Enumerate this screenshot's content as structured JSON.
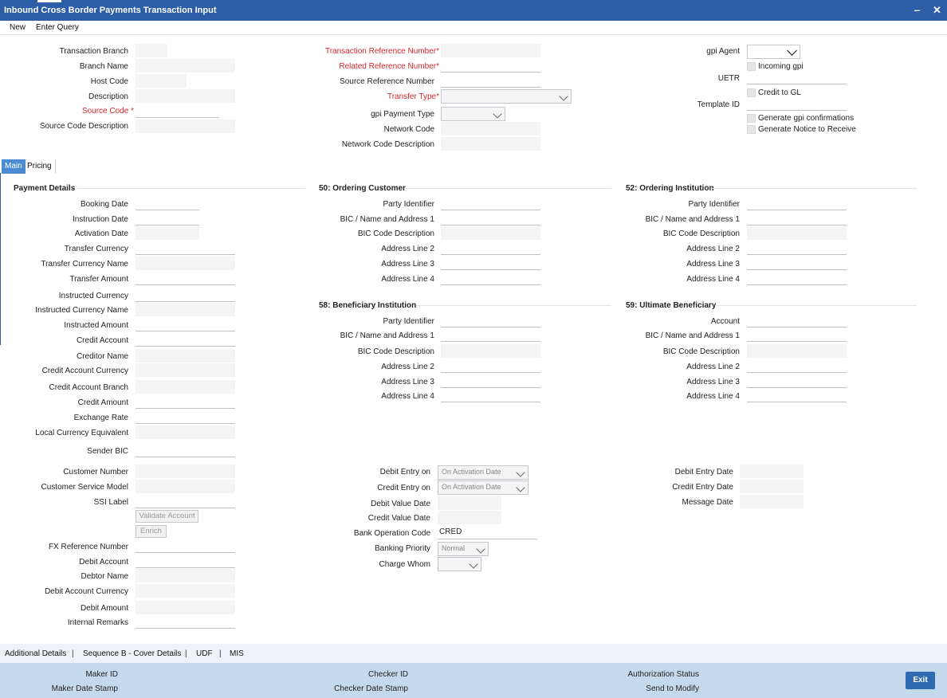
{
  "window": {
    "title": "Inbound Cross Border Payments Transaction Input",
    "minimize": "‒",
    "close": "✕"
  },
  "menu": {
    "new": "New",
    "enter_query": "Enter Query"
  },
  "header_left": {
    "transaction_branch": "Transaction Branch",
    "branch_name": "Branch Name",
    "host_code": "Host Code",
    "description": "Description",
    "source_code": "Source Code",
    "source_code_description": "Source Code Description"
  },
  "header_mid": {
    "txn_ref": "Transaction Reference Number",
    "related_ref": "Related Reference Number",
    "source_ref": "Source Reference Number",
    "transfer_type": "Transfer Type",
    "gpi_payment_type": "gpi Payment Type",
    "network_code": "Network Code",
    "network_code_desc": "Network Code Description"
  },
  "header_right": {
    "gpi_agent": "gpi Agent",
    "incoming_gpi": "Incoming gpi",
    "uetr": "UETR",
    "credit_to_gl": "Credit to GL",
    "template_id": "Template ID",
    "generate_gpi_confirmations": "Generate gpi confirmations",
    "generate_notice": "Generate Notice to Receive"
  },
  "required_mark": "*",
  "tabs": {
    "main": "Main",
    "pricing": "Pricing"
  },
  "payment_details": {
    "title": "Payment Details",
    "booking_date": "Booking Date",
    "instruction_date": "Instruction Date",
    "activation_date": "Activation Date",
    "transfer_currency": "Transfer Currency",
    "transfer_currency_name": "Transfer Currency Name",
    "transfer_amount": "Transfer Amount",
    "instructed_currency": "Instructed Currency",
    "instructed_currency_name": "Instructed Currency Name",
    "instructed_amount": "Instructed Amount",
    "credit_account": "Credit Account",
    "creditor_name": "Creditor Name",
    "credit_account_currency": "Credit Account Currency",
    "credit_account_branch": "Credit Account Branch",
    "credit_amount": "Credit Amount",
    "exchange_rate": "Exchange Rate",
    "local_currency_equivalent": "Local Currency Equivalent",
    "sender_bic": "Sender BIC",
    "customer_number": "Customer Number",
    "customer_service_model": "Customer Service Model",
    "ssi_label": "SSI Label",
    "validate_account": "Validate Account",
    "enrich": "Enrich",
    "fx_reference_number": "FX Reference Number",
    "debit_account": "Debit Account",
    "debtor_name": "Debtor Name",
    "debit_account_currency": "Debit Account Currency",
    "debit_amount": "Debit Amount",
    "internal_remarks": "Internal Remarks"
  },
  "ordering_customer": {
    "title": "50: Ordering Customer",
    "party_identifier": "Party Identifier",
    "bic_name_address": "BIC / Name and Address 1",
    "bic_code_description": "BIC Code Description",
    "address2": "Address Line 2",
    "address3": "Address Line 3",
    "address4": "Address Line 4"
  },
  "ordering_institution": {
    "title": "52: Ordering Institution",
    "party_identifier": "Party Identifier",
    "bic_name_address": "BIC / Name and Address 1",
    "bic_code_description": "BIC Code Description",
    "address2": "Address Line 2",
    "address3": "Address Line 3",
    "address4": "Address Line 4"
  },
  "beneficiary_institution": {
    "title": "58: Beneficiary Institution",
    "party_identifier": "Party Identifier",
    "bic_name_address": "BIC / Name and Address 1",
    "bic_code_description": "BIC Code Description",
    "address2": "Address Line 2",
    "address3": "Address Line 3",
    "address4": "Address Line 4"
  },
  "ultimate_beneficiary": {
    "title": "59: Ultimate Beneficiary",
    "account": "Account",
    "bic_name_address": "BIC / Name and Address 1",
    "bic_code_description": "BIC Code Description",
    "address2": "Address Line 2",
    "address3": "Address Line 3",
    "address4": "Address Line 4"
  },
  "entries": {
    "debit_entry_on": "Debit Entry on",
    "debit_entry_on_value": "On Activation Date",
    "credit_entry_on": "Credit Entry on",
    "credit_entry_on_value": "On Activation Date",
    "debit_value_date": "Debit Value Date",
    "credit_value_date": "Credit Value Date",
    "bank_operation_code": "Bank Operation Code",
    "bank_operation_code_value": "CRED",
    "banking_priority": "Banking Priority",
    "banking_priority_value": "Normal",
    "charge_whom": "Charge Whom"
  },
  "dates": {
    "debit_entry_date": "Debit Entry Date",
    "credit_entry_date": "Credit Entry Date",
    "message_date": "Message Date"
  },
  "bottom_links": {
    "additional_details": "Additional Details",
    "sequence_b": "Sequence B - Cover Details",
    "udf": "UDF",
    "mis": "MIS",
    "sep": "|"
  },
  "footer": {
    "maker_id": "Maker ID",
    "maker_date_stamp": "Maker Date Stamp",
    "checker_id": "Checker ID",
    "checker_date_stamp": "Checker Date Stamp",
    "authorization_status": "Authorization Status",
    "send_to_modify": "Send to Modify",
    "exit": "Exit"
  },
  "colors": {
    "title_bar": "#2b5ea7",
    "required": "#d8262c",
    "active_tab": "#4a8bd2",
    "footer": "#c5d9ec",
    "exit_button": "#2f6ab1"
  }
}
